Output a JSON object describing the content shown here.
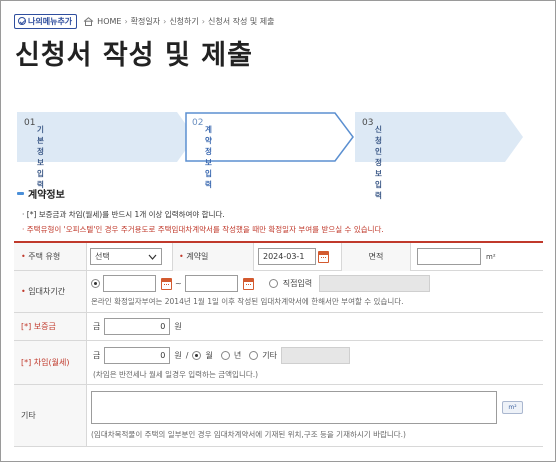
{
  "top": {
    "mymenu_label": "나의메뉴추가",
    "breadcrumb": [
      "HOME",
      "확정일자",
      "신청하기",
      "신청서 작성 및 제출"
    ]
  },
  "page_title": "신청서 작성 및 제출",
  "steps": [
    {
      "num": "01",
      "label": "기본정보 입력",
      "active": false
    },
    {
      "num": "02",
      "label": "계약정보 입력",
      "active": true
    },
    {
      "num": "03",
      "label": "신청인정보 입력",
      "active": false
    }
  ],
  "section_title": "계약정보",
  "notes": {
    "n1": "· [*] 보증금과 차임(월세)를 반드시 1개 이상 입력하여야 합니다.",
    "n2": "· 주택유형이 '오피스텔'인 경우 주거용도로 주택임대차계약서를 작성했을 때만 확정일자 부여를 받으실 수 있습니다."
  },
  "form": {
    "house_type": {
      "label": "주택 유형",
      "value": "선택"
    },
    "contract_date": {
      "label": "계약일",
      "value": "2024-03-1"
    },
    "area": {
      "label": "면적",
      "value": "",
      "unit": "m²"
    },
    "lease_period": {
      "label": "임대차기간",
      "start": "",
      "tilde": "~",
      "end": "",
      "direct_label": "직접입력",
      "direct_value": "",
      "help": "온라인 확정일자부여는 2014년 1월 1일 이후 작성된 임대차계약서에 한해서만 부여할 수 있습니다."
    },
    "deposit": {
      "label": "[*] 보증금",
      "prefix": "금",
      "value": "0",
      "unit": "원"
    },
    "rent": {
      "label": "[*] 차임(월세)",
      "prefix": "금",
      "value": "0",
      "unit": "원",
      "slash": "/",
      "opt1": "월",
      "opt2": "년",
      "opt3": "기타",
      "other_value": "",
      "help": "(차임은 반전세나 월세 일경우 입력하는 금액입니다.)"
    },
    "etc": {
      "label": "기타",
      "value": "",
      "m2_button": "m²",
      "help": "(임대차목적물이 주택의 일부분인 경우 임대차계약서에 기재된 위치,구조 등을 기재하시기 바랍니다.)"
    }
  }
}
